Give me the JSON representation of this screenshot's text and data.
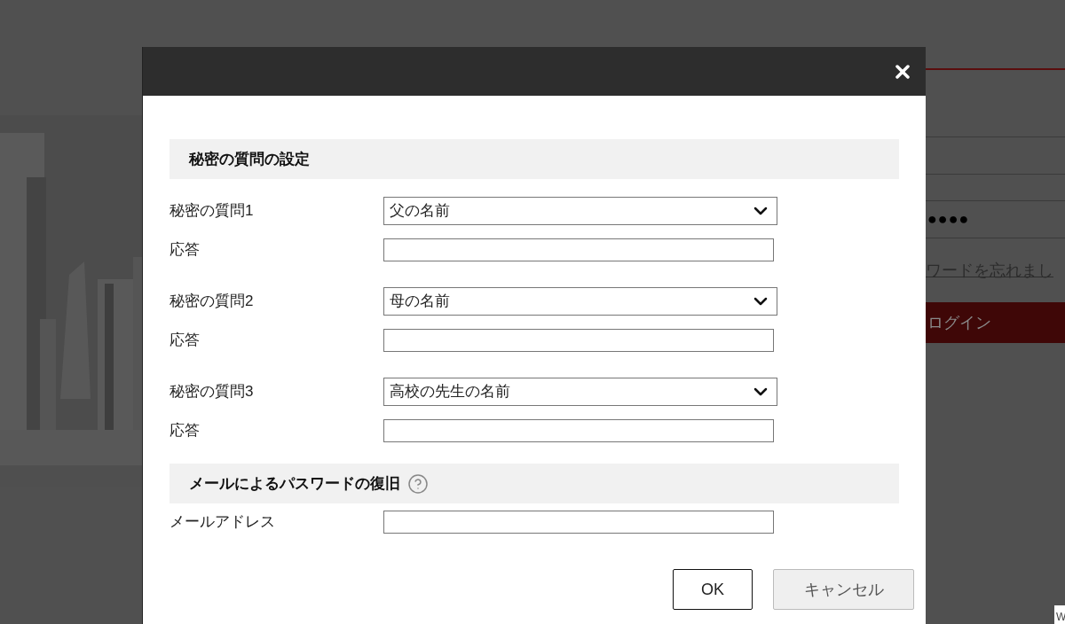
{
  "background": {
    "password_mask": "●●●●",
    "forgot_link": "ワードを忘れまし",
    "login_button": "ログイン",
    "corner_tag": "W"
  },
  "dialog": {
    "sections": [
      {
        "kind": "questions",
        "title": "秘密の質問の設定",
        "help": false,
        "questions": [
          {
            "label": "秘密の質問1",
            "value": "父の名前",
            "answer_label": "応答"
          },
          {
            "label": "秘密の質問2",
            "value": "母の名前",
            "answer_label": "応答"
          },
          {
            "label": "秘密の質問3",
            "value": "高校の先生の名前",
            "answer_label": "応答"
          }
        ]
      },
      {
        "kind": "fields",
        "title": "メールによるパスワードの復旧",
        "help": true,
        "fields": [
          {
            "label": "メールアドレス"
          }
        ]
      }
    ],
    "buttons": [
      {
        "label": "OK",
        "kind": "primary"
      },
      {
        "label": "キャンセル",
        "kind": "secondary"
      }
    ]
  }
}
